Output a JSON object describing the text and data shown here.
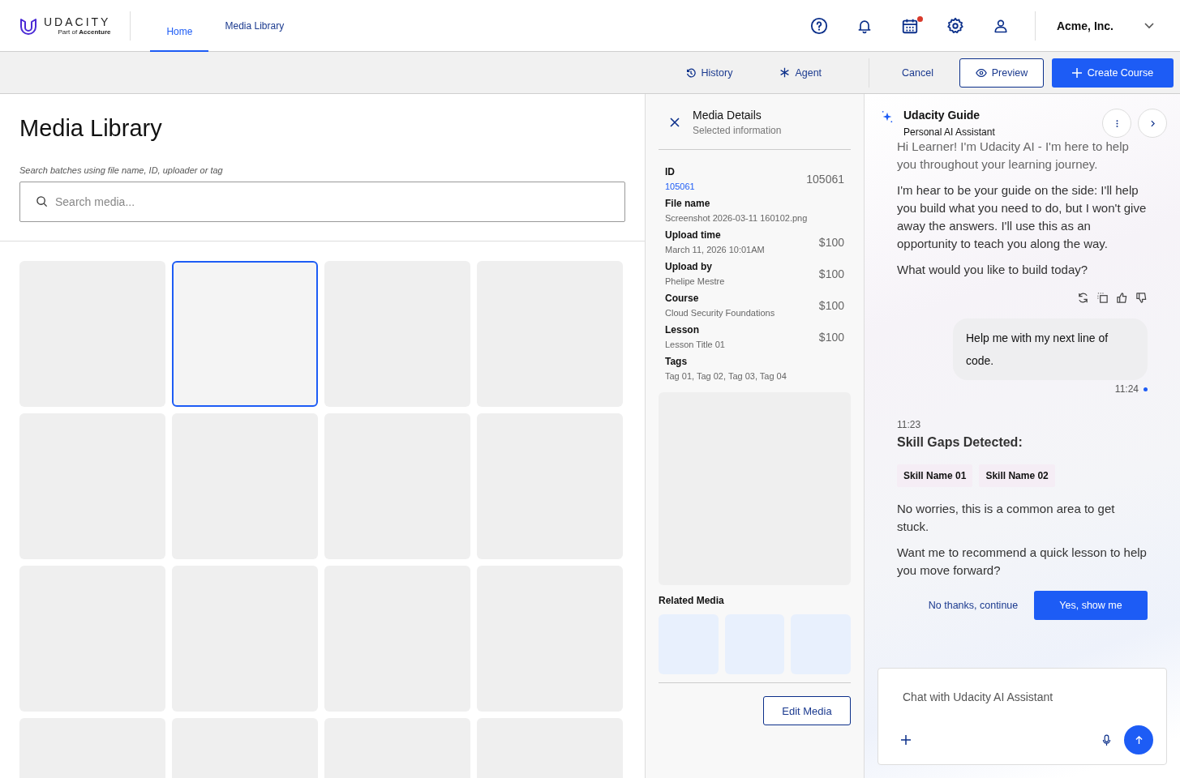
{
  "header": {
    "logo": {
      "wordmark": "UDACITY",
      "tagline": "Part of **Accenture**"
    },
    "nav": [
      {
        "label": "Home",
        "selected": true
      },
      {
        "label": "Media Library",
        "selected": false
      }
    ],
    "icons": [
      {
        "kind": "help",
        "badge": false
      },
      {
        "kind": "bell",
        "badge": false
      },
      {
        "kind": "calendar",
        "badge": true
      },
      {
        "kind": "settings",
        "badge": false
      },
      {
        "kind": "user",
        "badge": false
      }
    ],
    "account": "Acme, Inc."
  },
  "toolbar": {
    "links": [
      {
        "kind": "history",
        "label": "History"
      },
      {
        "kind": "agent",
        "label": "Agent"
      }
    ],
    "cancel": "Cancel",
    "preview": "Preview",
    "create": "Create Course"
  },
  "library": {
    "title": "Media Library",
    "hint": "Search batches using file name, ID, uploader or tag",
    "search": {
      "placeholder": "Search media..."
    },
    "tiles": [
      {
        "selected": false
      },
      {
        "selected": true
      },
      {
        "selected": false
      },
      {
        "selected": false
      },
      {
        "selected": false
      },
      {
        "selected": false
      },
      {
        "selected": false
      },
      {
        "selected": false
      },
      {
        "selected": false
      },
      {
        "selected": false
      },
      {
        "selected": false
      },
      {
        "selected": false
      },
      {
        "selected": false
      },
      {
        "selected": false
      },
      {
        "selected": false
      },
      {
        "selected": false
      }
    ]
  },
  "details": {
    "title": "Media Details",
    "subtitle": "Selected information",
    "fields": [
      {
        "label": "ID",
        "value": "105061",
        "kind": "link",
        "amount": "105061"
      },
      {
        "label": "File name",
        "value": "Screenshot 2026-03-11 160102.png",
        "kind": "text"
      },
      {
        "label": "Upload time",
        "value": "March 11, 2026 10:01AM",
        "kind": "text",
        "amount": "$100"
      },
      {
        "label": "Upload by",
        "value": "Phelipe Mestre",
        "kind": "text",
        "amount": "$100"
      },
      {
        "label": "Course",
        "value": "Cloud Security Foundations",
        "kind": "text",
        "amount": "$100"
      },
      {
        "label": "Lesson",
        "value": "Lesson Title 01",
        "kind": "text",
        "amount": "$100"
      },
      {
        "label": "Tags",
        "value": "Tag 01, Tag 02, Tag 03, Tag 04",
        "kind": "text"
      }
    ],
    "related_title": "Related Media",
    "related_media": [
      {
        "kind": "placeholder"
      },
      {
        "kind": "placeholder"
      },
      {
        "kind": "placeholder"
      }
    ],
    "edit": "Edit Media"
  },
  "chat": {
    "title": "Udacity Guide",
    "subtitle": "Personal AI Assistant",
    "intro": [
      "Hi Learner! I'm Udacity AI - I'm here to help you throughout your learning journey.",
      "I'm hear to be your guide on the side: I'll help you build what you need to do, but I won't give away the answers. I'll use this as an opportunity to teach you along the way.",
      "What would you like to build today?"
    ],
    "user_message": {
      "text": "Help me with my next line of code.",
      "time": "11:24"
    },
    "reply": {
      "time": "11:23",
      "heading": "Skill Gaps Detected:",
      "skills": [
        "Skill Name 01",
        "Skill Name 02"
      ],
      "paragraphs": [
        "No worries, this is a common area to get stuck.",
        "Want me to recommend a quick lesson to help you move forward?"
      ],
      "decline": "No thanks, continue",
      "accept": "Yes, show me"
    },
    "input": {
      "placeholder": "Chat with Udacity AI Assistant"
    }
  }
}
